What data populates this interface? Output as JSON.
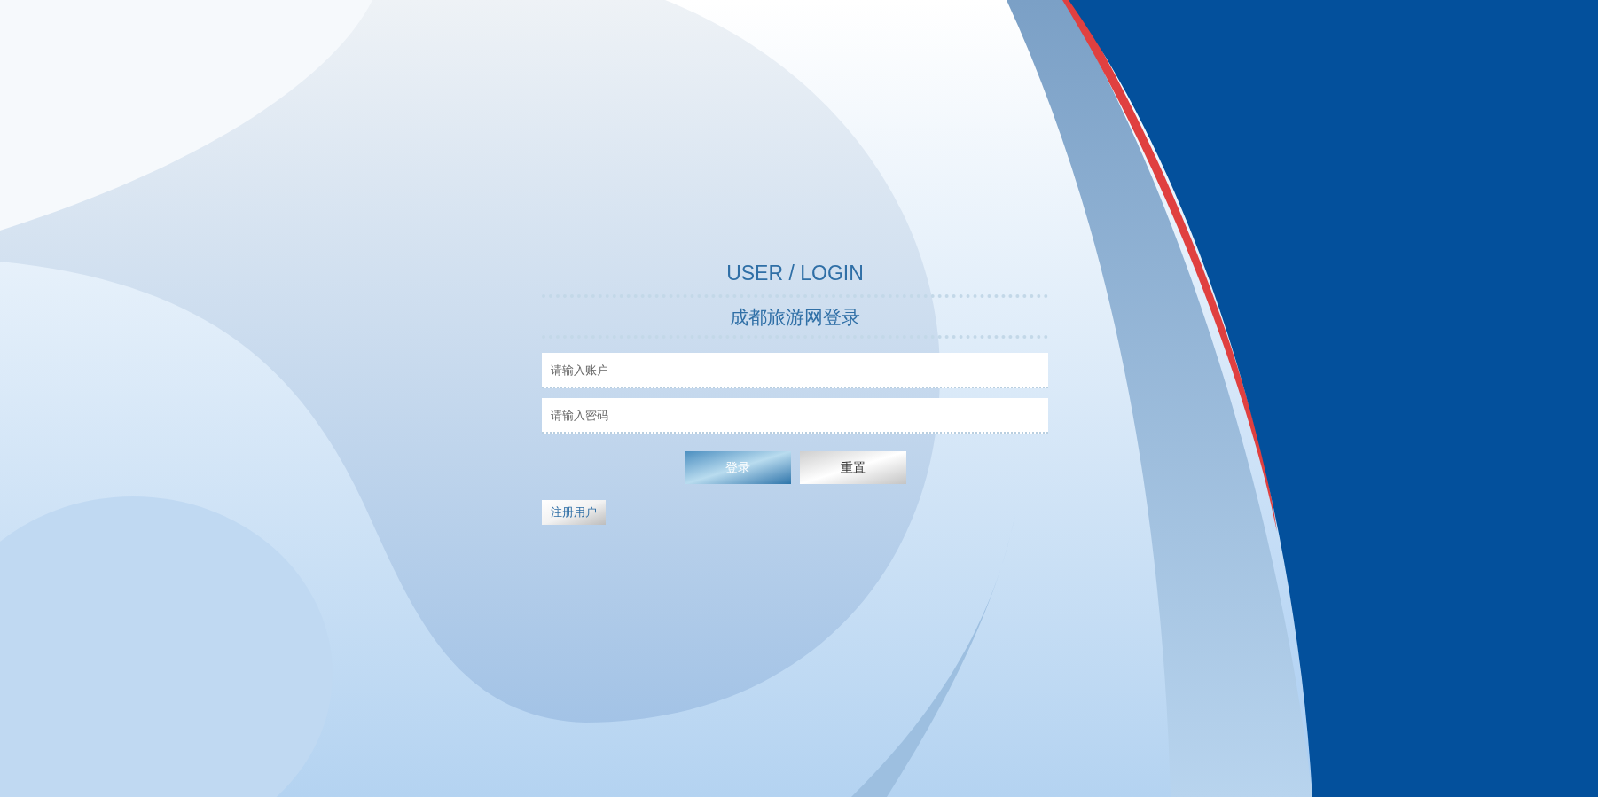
{
  "heading": "USER / LOGIN",
  "subheading": "成都旅游网登录",
  "fields": [
    {
      "placeholder": "请输入账户"
    },
    {
      "placeholder": "请输入密码"
    }
  ],
  "buttons": [
    {
      "kind": "primary",
      "label": "登录"
    },
    {
      "kind": "secondary",
      "label": "重置"
    }
  ],
  "register_link": "注册用户"
}
